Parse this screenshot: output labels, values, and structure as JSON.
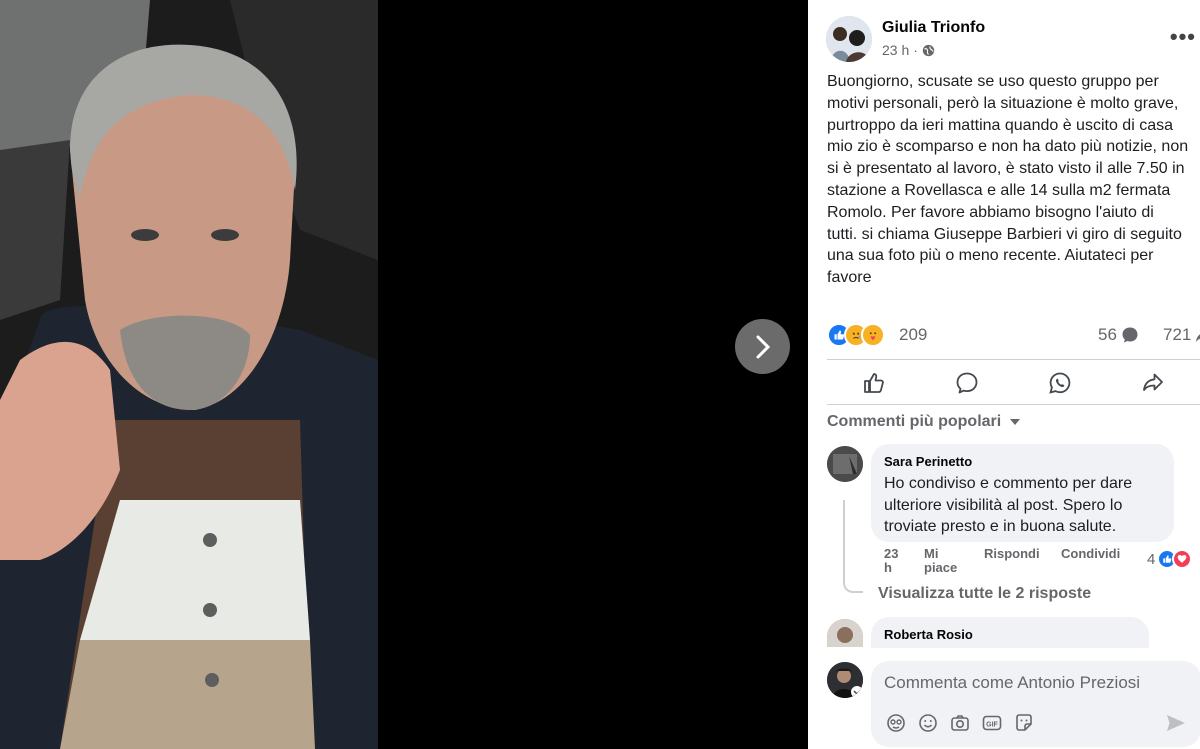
{
  "post": {
    "author": "Giulia Trionfo",
    "time": "23 h",
    "separator": "·",
    "text": "Buongiorno, scusate se uso questo gruppo per\nmotivi personali, però la situazione è molto grave,\npurtroppo da ieri mattina quando è uscito di casa\nmio zio è scomparso e non ha dato più notizie, non\nsi è presentato al lavoro, è stato visto il alle 7.50 in\nstazione a Rovellasca e alle 14 sulla m2 fermata\nRomolo. Per favore abbiamo bisogno l'aiuto di\ntutti. si chiama Giuseppe Barbieri vi giro di seguito\nuna sua foto più o meno recente. Aiutateci per\nfavore",
    "reactions_count": "209",
    "comments_count": "56",
    "shares_count": "721"
  },
  "sort_label": "Commenti più popolari",
  "comments": [
    {
      "author": "Sara Perinetto",
      "text": "Ho condiviso e commento per dare\nulteriore visibilità al post. Spero lo\ntroviate presto e in buona salute.",
      "time": "23\nh",
      "like_label": "Mi\npiace",
      "reply_label": "Rispondi",
      "share_label": "Condividi",
      "reactions_count": "4",
      "view_replies": "Visualizza tutte le 2 risposte"
    },
    {
      "author": "Roberta Rosio"
    }
  ],
  "composer": {
    "placeholder": "Commenta come Antonio Preziosi"
  },
  "colors": {
    "like_blue": "#1877f2",
    "love_red": "#f33e58",
    "care_yellow": "#f7b125"
  },
  "icons": [
    "chevron-right-icon",
    "globe-icon",
    "more-icon",
    "like-icon",
    "comment-icon",
    "whatsapp-icon",
    "share-icon",
    "sort-caret-icon",
    "emoji-icon",
    "camera-icon",
    "gif-icon",
    "sticker-icon",
    "send-icon",
    "avatar-icon"
  ]
}
